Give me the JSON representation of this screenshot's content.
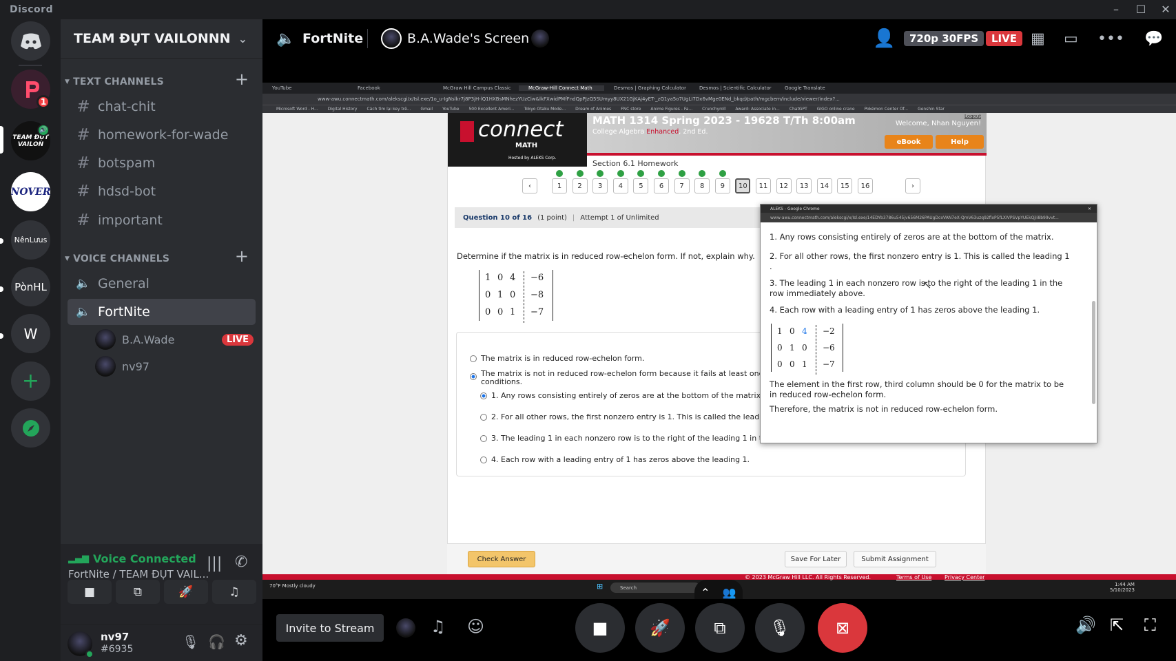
{
  "app_title": "Discord",
  "servers": [
    {
      "label": "NênLưus"
    },
    {
      "label": "PònHL"
    },
    {
      "label": "W"
    }
  ],
  "servers_badge": "1",
  "team_server_label": "TEAM ĐỤT VAILON",
  "dev_server_label": "NOVER",
  "guild_name": "TEAM ĐỤT VAILONNN",
  "text_category": "TEXT CHANNELS",
  "text_channels": [
    "chat-chit",
    "homework-for-wade",
    "botspam",
    "hdsd-bot",
    "important"
  ],
  "voice_category": "VOICE CHANNELS",
  "voice_channels": [
    "General",
    "FortNite"
  ],
  "voice_users": [
    {
      "name": "B.A.Wade",
      "live": "LIVE"
    },
    {
      "name": "nv97"
    }
  ],
  "voice_status": {
    "title": "Voice Connected",
    "subtitle": "FortNite / TEAM ĐỤT VAIL..."
  },
  "user": {
    "name": "nv97",
    "tag": "#6935"
  },
  "stage": {
    "channel": "FortNite",
    "screen_title": "B.A.Wade's Screen",
    "quality": "720p 30FPS",
    "live": "LIVE"
  },
  "bottom": {
    "invite": "Invite to Stream"
  },
  "browser": {
    "tabs": [
      "YouTube",
      "Facebook",
      "McGraw Hill Campus Classic",
      "McGraw-Hill Connect Math",
      "Desmos | Graphing Calculator",
      "Desmos | Scientific Calculator",
      "Google Translate"
    ],
    "url": "www-awu.connectmath.com/alekscgi/x/Isl.exe/1o_u-IgNslkr7j8P3jH-lQ1HXBsMNhezYUzCiw&lkFXwidPMfFndQpPJzQ5SUmyy8UX21GjKAj4yET-_zQ1ya5o7UgLI7Dx6vMge0ENd_bkqd/path/mgcbem/include/viewer/index?...",
    "bookmarks": [
      "Microsoft Word - H...",
      "Digital History",
      "Cách tìm lại key trê...",
      "Gmail",
      "YouTube",
      "500 Excellent Ameri...",
      "Tokyo Otaku Mode...",
      "Dream of Animes",
      "FNC store",
      "Anime Figures - Fa...",
      "Crunchyroll",
      "Award: Associate in...",
      "ChatGPT",
      "GIGO online crane",
      "Pokémon Center Of...",
      "Genshin Star"
    ]
  },
  "connect": {
    "logo": "connect",
    "logo_sub": "MATH",
    "hosted": "Hosted by ALEKS Corp.",
    "course": "MATH 1314 Spring 2023 - 19628 T/Th 8:00am",
    "book_pre": "College Algebra ",
    "book_enh": "Enhanced",
    "book_post": ", 2nd Ed.",
    "logout": "Logout",
    "welcome": "Welcome, Nhan Nguyen!",
    "ebook": "eBook",
    "help": "Help",
    "section": "Section 6.1 Homework",
    "nav": [
      "1",
      "2",
      "3",
      "4",
      "5",
      "6",
      "7",
      "8",
      "9",
      "10",
      "11",
      "12",
      "13",
      "14",
      "15",
      "16"
    ],
    "question": "Question 10 of 16",
    "points": "(1 point)",
    "attempt": "Attempt 1 of Unlimited",
    "prompt": "Determine if the matrix is in reduced row-echelon form. If not, explain why.",
    "matrix": [
      [
        "1",
        "0",
        "4",
        "−6"
      ],
      [
        "0",
        "1",
        "0",
        "−8"
      ],
      [
        "0",
        "0",
        "1",
        "−7"
      ]
    ],
    "opt_a": "The matrix is in reduced row-echelon form.",
    "opt_b1": "The matrix is not in reduced row-echelon form because it fails at least one",
    "opt_b2": "conditions.",
    "sub": [
      "1. Any rows consisting entirely of zeros are at the bottom of the matrix",
      "2. For all other rows, the first nonzero entry is 1. This is called the leadi",
      "3. The leading 1 in each nonzero row is to the right of the leading 1 in the row immediately above.",
      "4. Each row with a leading entry of 1 has zeros above the leading 1."
    ],
    "check": "Check Answer",
    "save": "Save For Later",
    "submit": "Submit Assignment",
    "copyright": "© 2023 McGraw Hill LLC. All Rights Reserved.",
    "terms": "Terms of Use",
    "privacy": "Privacy Center"
  },
  "popup": {
    "title": "ALEKS - Google Chrome",
    "url": "www-awu.connectmath.com/alekscgi/x/Isl.exe/14EDYb3786u545jv656M26PAUgDcoVAN7eX-QmV63uzq92flxP5fLXIVPSVpYUEkQjIi8b99vvt...",
    "rules": [
      "1. Any rows consisting entirely of zeros are at the bottom of the matrix.",
      "2. For all other rows, the first nonzero entry is 1. This is called the leading 1 .",
      "3. The leading 1 in each nonzero row is to the right of the leading 1 in the row immediately above.",
      "4. Each row with a leading entry of 1 has zeros above the leading 1."
    ],
    "matrix": [
      [
        "1",
        "0",
        "4",
        "−2"
      ],
      [
        "0",
        "1",
        "0",
        "−6"
      ],
      [
        "0",
        "0",
        "1",
        "−7"
      ]
    ],
    "explain": "The element in the first row, third column should be 0 for the matrix to be in reduced row-echelon form.",
    "conclusion": "Therefore, the matrix is not in reduced row-echelon form."
  },
  "taskbar": {
    "weather": "70°F",
    "weather_sub": "Mostly cloudy",
    "search": "Search",
    "time": "1:44 AM",
    "date": "5/10/2023"
  },
  "colors": {
    "accent": "#5865f2",
    "live": "#da373c",
    "green": "#23a55a",
    "mcgraw_red": "#c8102e"
  }
}
